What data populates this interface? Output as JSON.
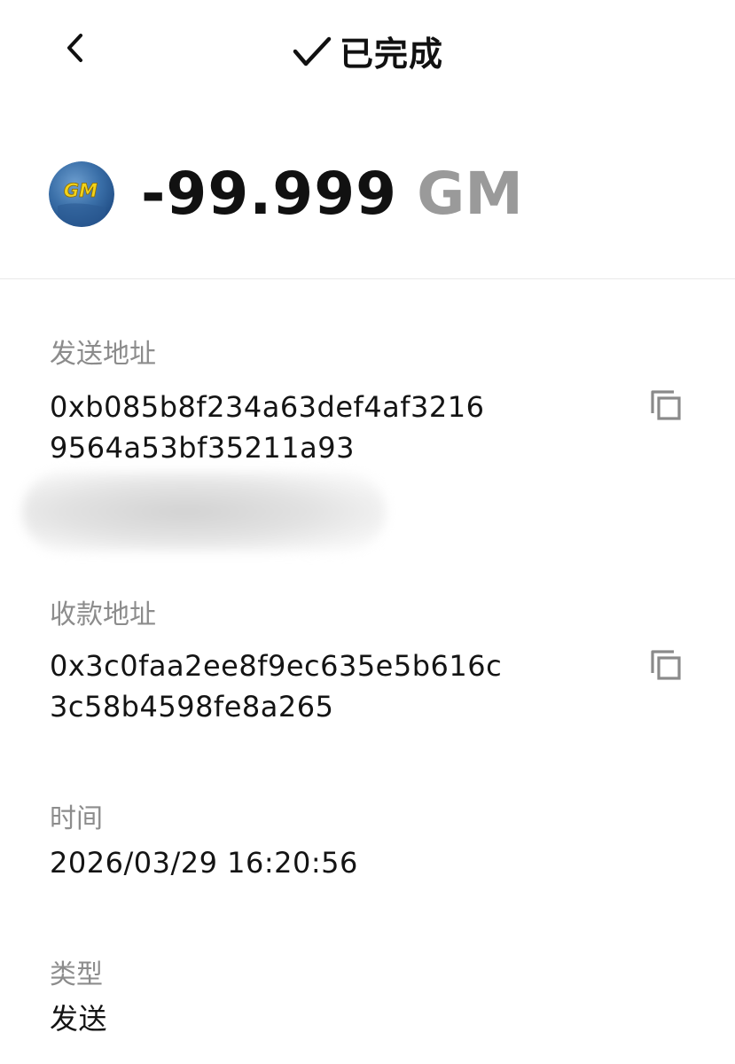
{
  "header": {
    "status_text": "已完成",
    "back_icon": "chevron-left-icon",
    "status_icon": "checkmark-icon"
  },
  "transaction": {
    "amount": "-99.999",
    "symbol": "GM",
    "token_logo_text": "GM",
    "token_icon": "gm-token-logo"
  },
  "details": {
    "sender_label": "发送地址",
    "sender_line1": "0xb085b8f234a63def4af3216",
    "sender_line2": "9564a53bf35211a93",
    "receiver_label": "收款地址",
    "receiver_line1": "0x3c0faa2ee8f9ec635e5b616c",
    "receiver_line2": "3c58b4598fe8a265",
    "time_label": "时间",
    "time_value": "2026/03/29 16:20:56",
    "type_label": "类型",
    "type_value": "发送",
    "copy_icon": "copy-icon"
  },
  "colors": {
    "label": "#8c8c8c",
    "text": "#141414",
    "symbol": "#9a9a9a",
    "divider": "#e8e8e8",
    "token_bg": "#2a5d9a",
    "token_text": "#f2d21a"
  }
}
